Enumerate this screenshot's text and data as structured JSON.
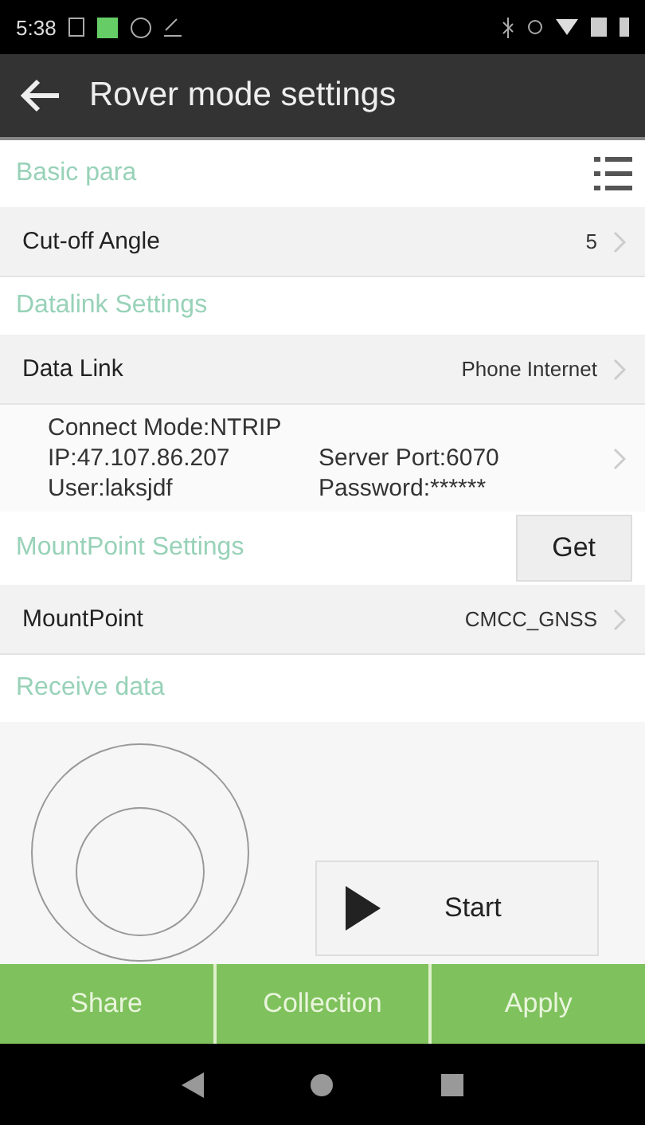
{
  "status_bar": {
    "time": "5:38"
  },
  "toolbar": {
    "title": "Rover mode settings"
  },
  "basic": {
    "header": "Basic para",
    "rows": [
      {
        "label": "Cut-off Angle",
        "value": "5"
      }
    ]
  },
  "datalink": {
    "header": "Datalink Settings",
    "rows": [
      {
        "label": "Data Link",
        "value": "Phone Internet"
      }
    ],
    "info": {
      "mode": "Connect Mode:NTRIP",
      "ip": "IP:47.107.86.207",
      "port": "Server Port:6070",
      "user": "User:laksjdf",
      "password": "Password:******"
    }
  },
  "mountpoint": {
    "header": "MountPoint Settings",
    "button": "Get",
    "rows": [
      {
        "label": "MountPoint",
        "value": "CMCC_GNSS"
      }
    ]
  },
  "receive": {
    "header": "Receive data",
    "button": "Start"
  },
  "actions": [
    "Share",
    "Collection",
    "Apply"
  ]
}
